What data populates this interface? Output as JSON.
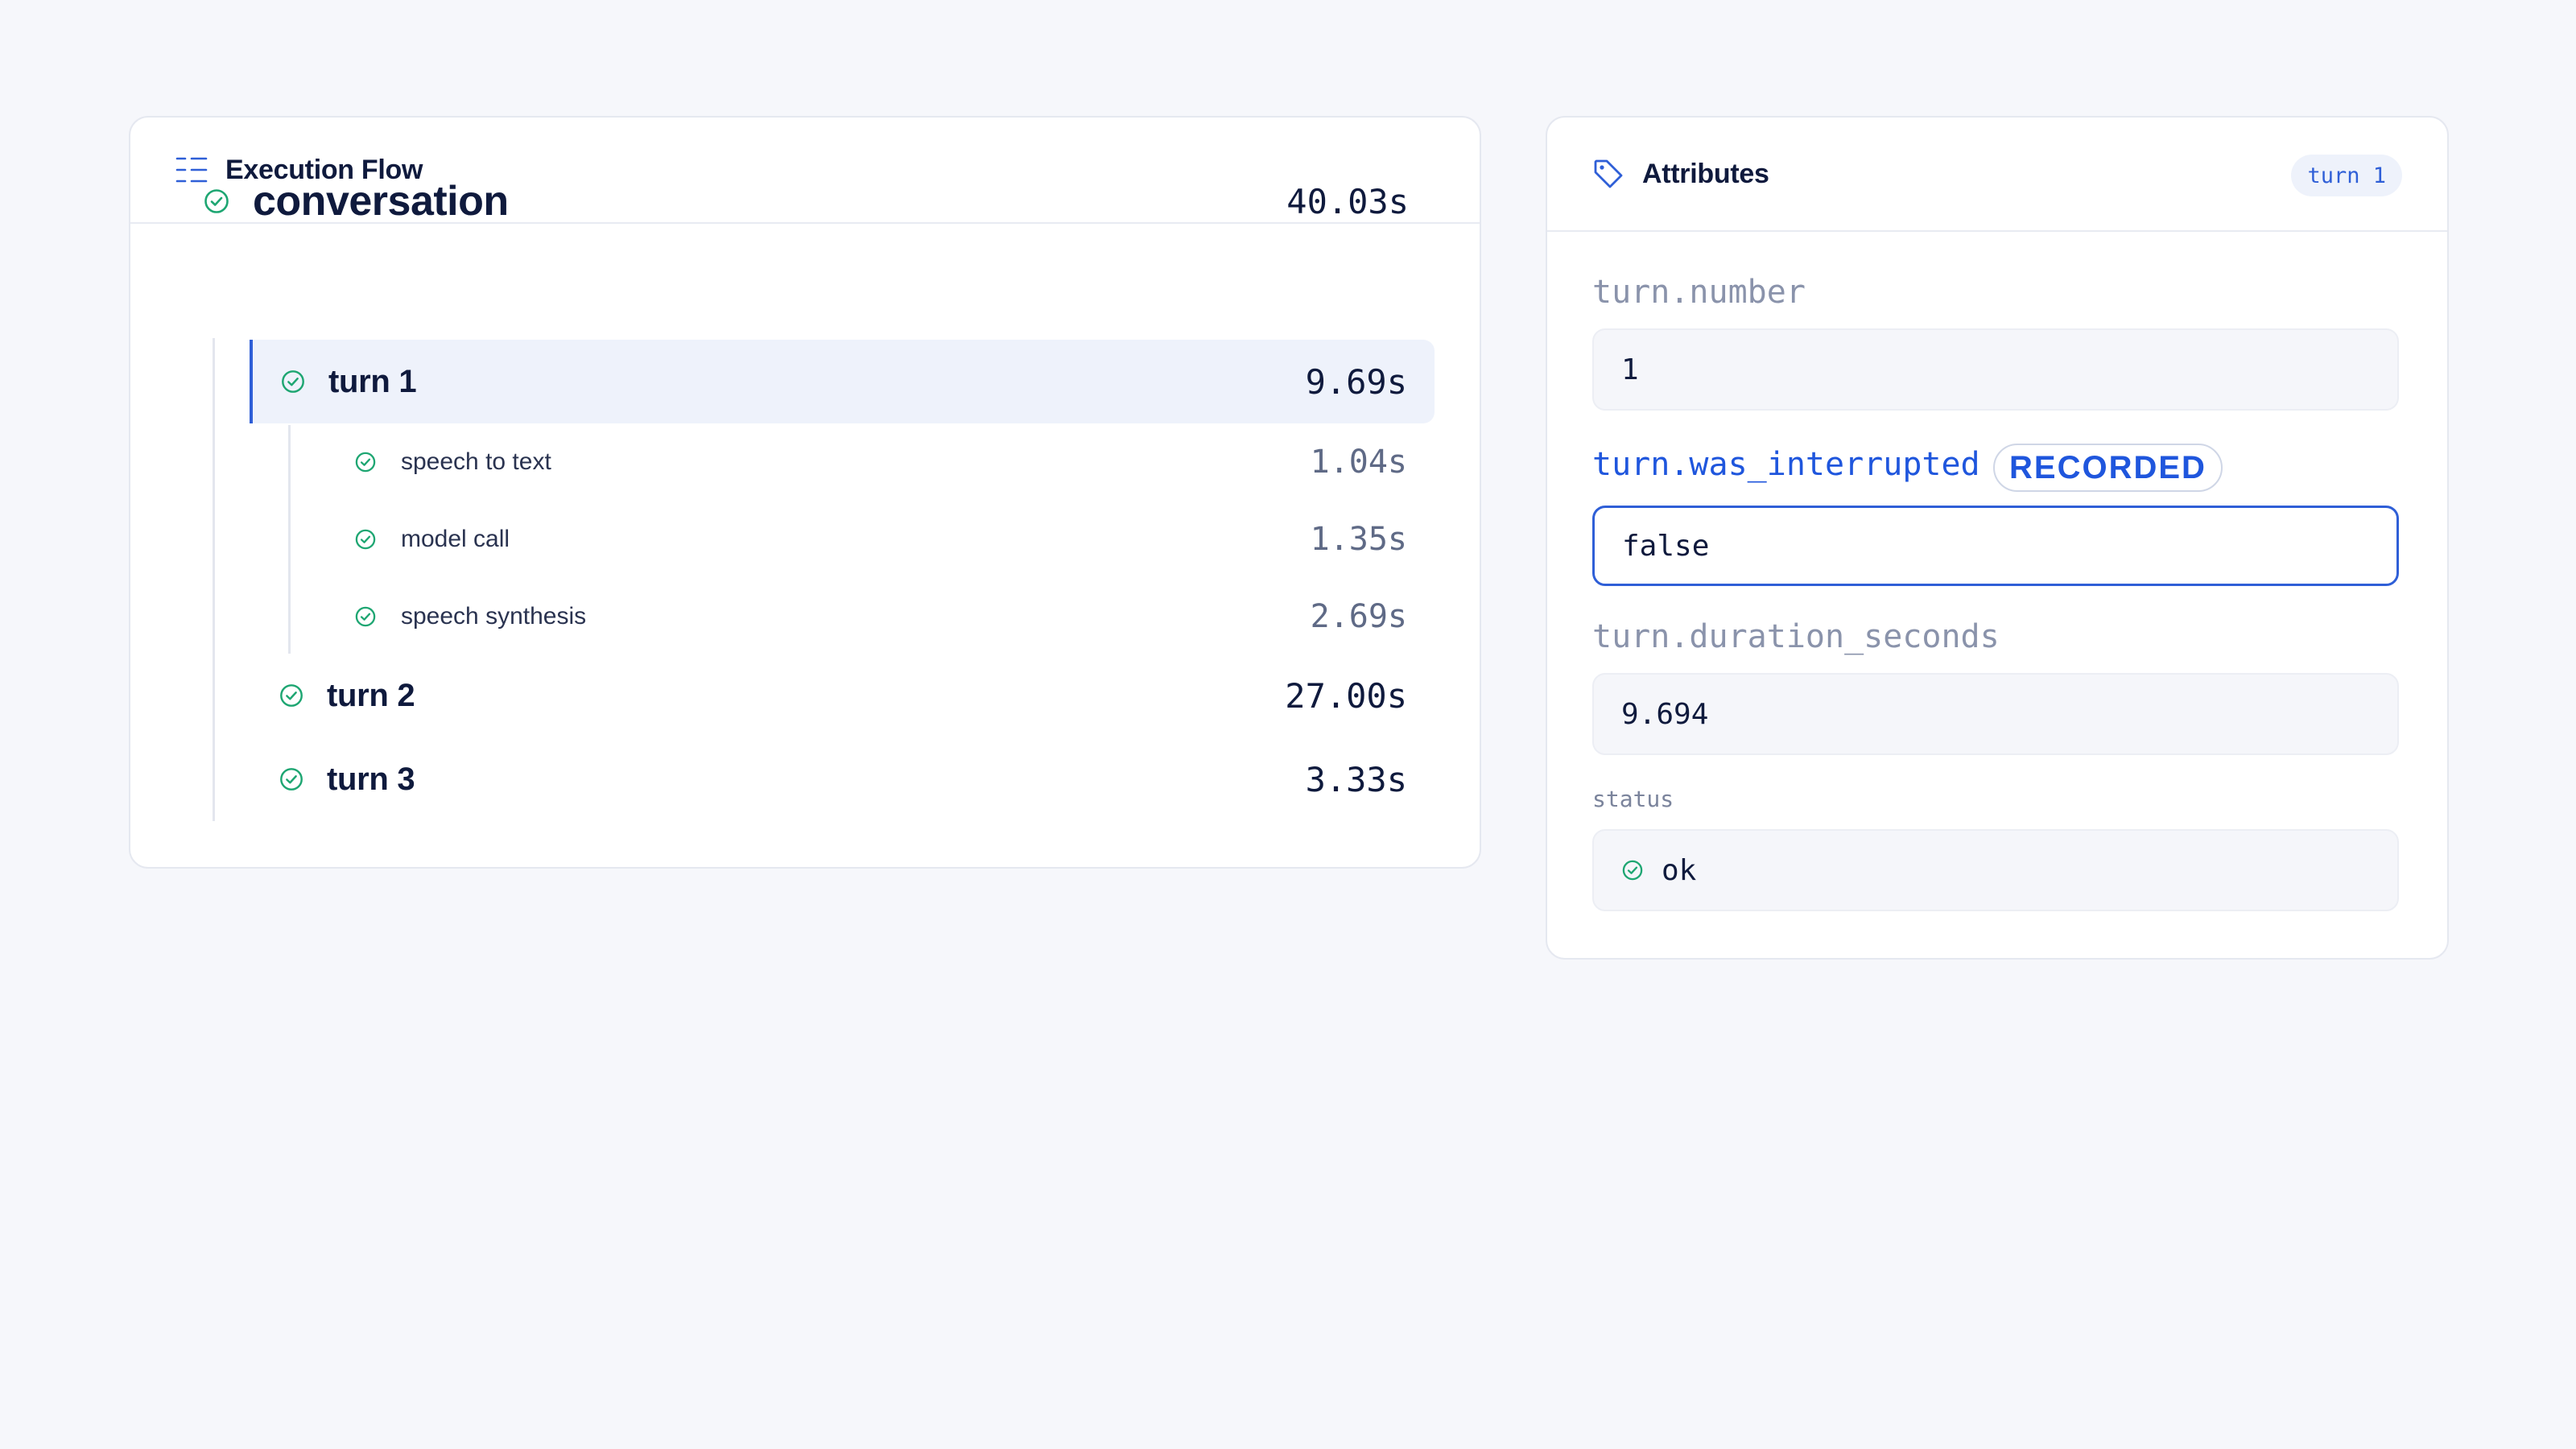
{
  "flow": {
    "title": "Execution Flow",
    "icon": "list-tree-icon",
    "root": {
      "label": "conversation",
      "duration": "40.03s",
      "status": "ok"
    },
    "turns": [
      {
        "label": "turn 1",
        "duration": "9.69s",
        "selected": true,
        "children": [
          {
            "label": "speech to text",
            "duration": "1.04s"
          },
          {
            "label": "model call",
            "duration": "1.35s"
          },
          {
            "label": "speech synthesis",
            "duration": "2.69s"
          }
        ]
      },
      {
        "label": "turn 2",
        "duration": "27.00s"
      },
      {
        "label": "turn 3",
        "duration": "3.33s"
      }
    ]
  },
  "attributes": {
    "title": "Attributes",
    "icon": "tag-icon",
    "badge": "turn 1",
    "items": [
      {
        "key": "turn.number",
        "value": "1"
      },
      {
        "key": "turn.was_interrupted",
        "value": "false",
        "tag": "RECORDED",
        "focused": true
      },
      {
        "key": "turn.duration_seconds",
        "value": "9.694"
      }
    ],
    "status": {
      "key": "status",
      "value": "ok"
    }
  },
  "colors": {
    "accent": "#2f5fd7",
    "success": "#1ea672",
    "text": "#0f1a3d",
    "muted": "#8a93ab",
    "selected_bg": "#eef2fb"
  }
}
